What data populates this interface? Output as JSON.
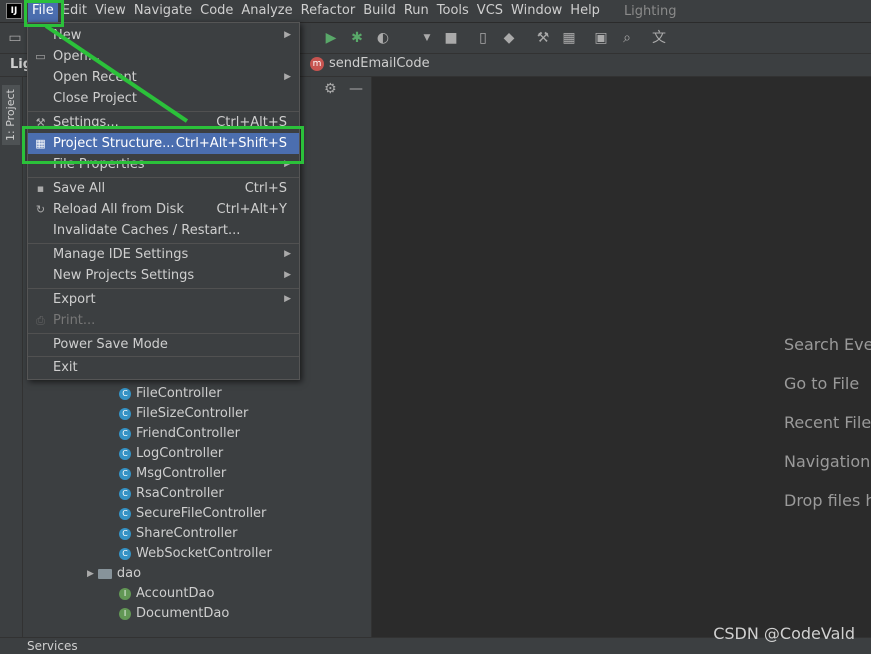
{
  "menubar": {
    "app_logo": "IJ",
    "items": [
      "File",
      "Edit",
      "View",
      "Navigate",
      "Code",
      "Analyze",
      "Refactor",
      "Build",
      "Run",
      "Tools",
      "VCS",
      "Window",
      "Help"
    ],
    "project_name": "Lighting"
  },
  "navbar": {
    "project_short": "Lig",
    "method_icon_letter": "m",
    "method_name": "sendEmailCode"
  },
  "left_stripe": {
    "project_tab": "1: Project"
  },
  "file_menu": {
    "items": [
      {
        "label": "New",
        "shortcut": "",
        "submenu": true,
        "icon": ""
      },
      {
        "label": "Open...",
        "shortcut": "",
        "submenu": false,
        "icon": "folder-open-icon"
      },
      {
        "label": "Open Recent",
        "shortcut": "",
        "submenu": true,
        "icon": ""
      },
      {
        "label": "Close Project",
        "shortcut": "",
        "submenu": false,
        "icon": ""
      },
      {
        "label": "Settings...",
        "shortcut": "Ctrl+Alt+S",
        "submenu": false,
        "icon": "wrench-icon"
      },
      {
        "label": "Project Structure...",
        "shortcut": "Ctrl+Alt+Shift+S",
        "submenu": false,
        "icon": "project-structure-icon"
      },
      {
        "label": "File Properties",
        "shortcut": "",
        "submenu": true,
        "icon": ""
      },
      {
        "label": "Save All",
        "shortcut": "Ctrl+S",
        "submenu": false,
        "icon": "save-icon"
      },
      {
        "label": "Reload All from Disk",
        "shortcut": "Ctrl+Alt+Y",
        "submenu": false,
        "icon": "reload-icon"
      },
      {
        "label": "Invalidate Caches / Restart...",
        "shortcut": "",
        "submenu": false,
        "icon": ""
      },
      {
        "label": "Manage IDE Settings",
        "shortcut": "",
        "submenu": true,
        "icon": ""
      },
      {
        "label": "New Projects Settings",
        "shortcut": "",
        "submenu": true,
        "icon": ""
      },
      {
        "label": "Export",
        "shortcut": "",
        "submenu": true,
        "icon": ""
      },
      {
        "label": "Print...",
        "shortcut": "",
        "submenu": false,
        "icon": "print-icon",
        "disabled": true
      },
      {
        "label": "Power Save Mode",
        "shortcut": "",
        "submenu": false,
        "icon": ""
      },
      {
        "label": "Exit",
        "shortcut": "",
        "submenu": false,
        "icon": ""
      }
    ],
    "selected": "Project Structure..."
  },
  "project_tree": {
    "controllers": [
      "FileController",
      "FileSizeController",
      "FriendController",
      "LogController",
      "MsgController",
      "RsaController",
      "SecureFileController",
      "ShareController",
      "WebSocketController"
    ],
    "folder": "dao",
    "dao_items": [
      "AccountDao",
      "DocumentDao"
    ]
  },
  "editor_hints": [
    "Search Ever",
    "Go to File",
    "Recent Files",
    "Navigation",
    "Drop files h"
  ],
  "bottom": {
    "services": "Services",
    "watermark": "CSDN @CodeVald"
  },
  "colors": {
    "highlight_green": "#2bc13a",
    "selection_blue": "#4b6eaf"
  }
}
